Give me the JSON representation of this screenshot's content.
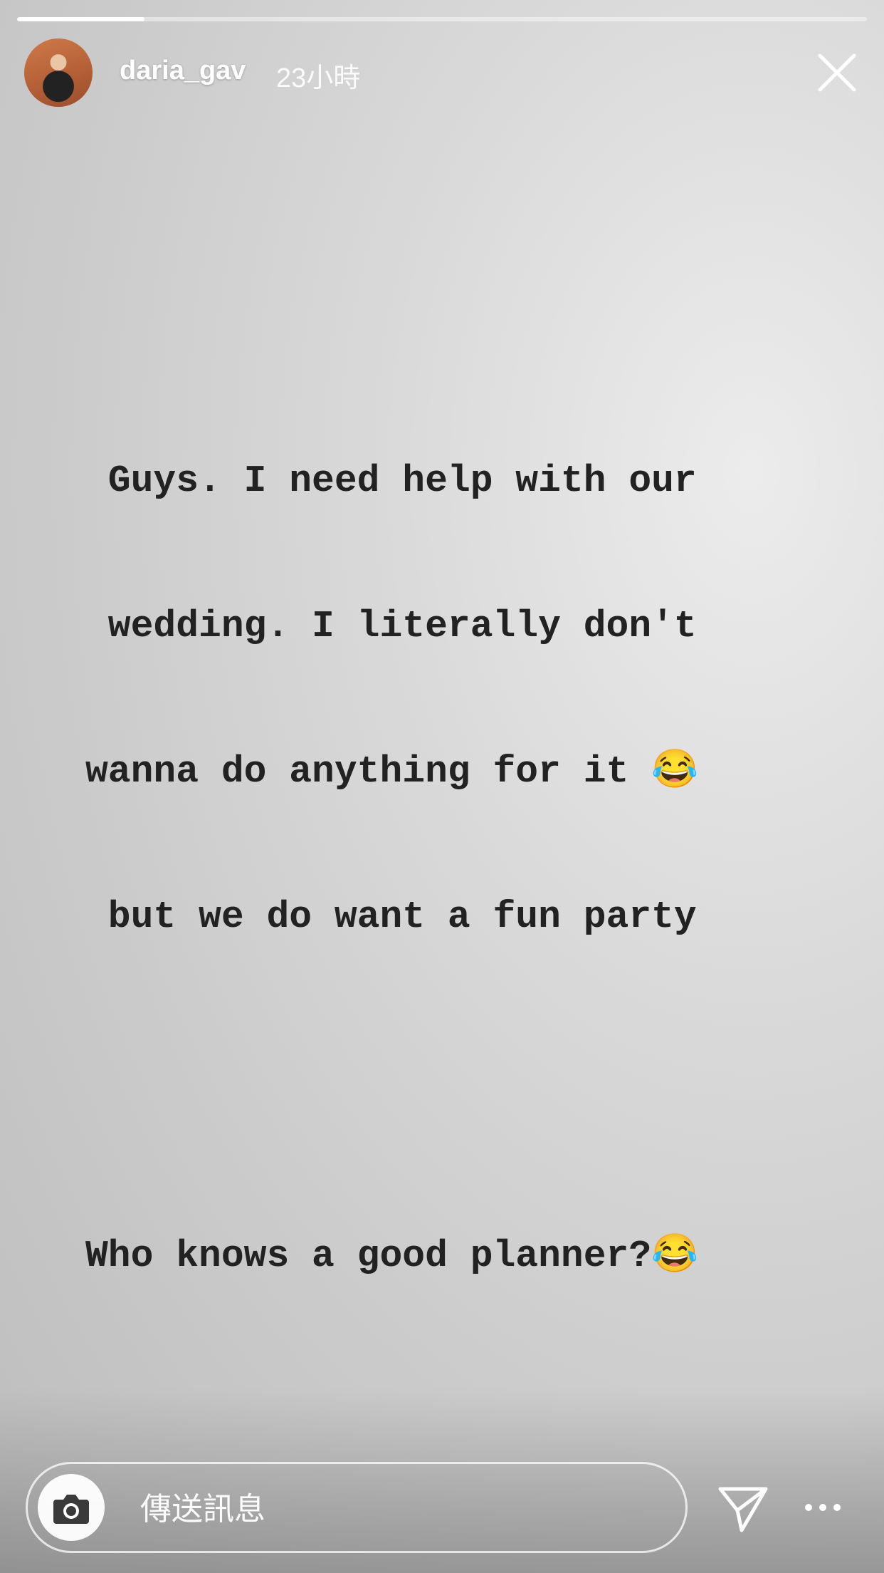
{
  "story": {
    "progress": 0.15,
    "username": "daria_gav",
    "time_ago": "23小時",
    "lines": [
      " Guys. I need help with our",
      " wedding. I literally don't",
      "wanna do anything for it 😂",
      " but we do want a fun party",
      "",
      "",
      "Who knows a good planner?😂"
    ]
  },
  "reply": {
    "placeholder": "傳送訊息"
  },
  "icons": {
    "close": "close-icon",
    "camera": "camera-icon",
    "send": "send-icon",
    "more": "more-icon"
  }
}
